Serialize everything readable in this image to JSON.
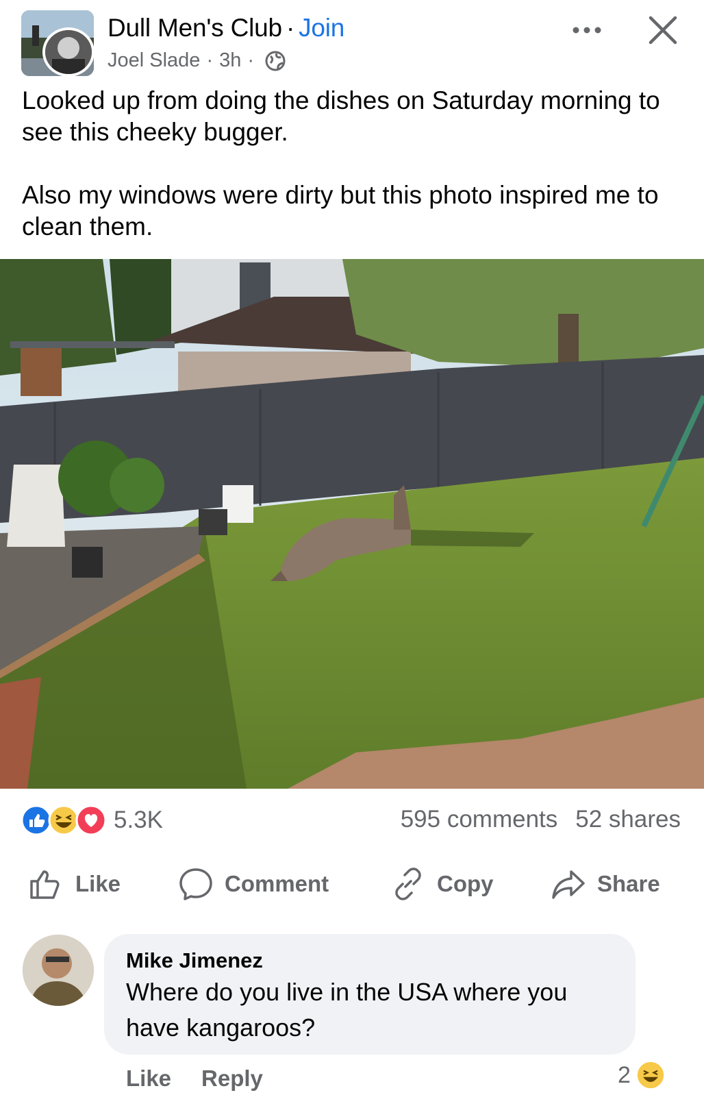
{
  "header": {
    "group_name": "Dull Men's Club",
    "separator": "·",
    "join_label": "Join",
    "author": "Joel Slade",
    "meta_separator": "·",
    "time": "3h",
    "audience_icon": "globe-icon",
    "more_icon": "more-icon",
    "close_icon": "close-icon"
  },
  "post": {
    "paragraph_1": "Looked up from doing the dishes on Saturday morning to see this cheeky bugger.",
    "paragraph_2": "Also my windows were dirty but this photo inspired me to clean them."
  },
  "reactions": {
    "icons": [
      "like-icon",
      "haha-icon",
      "love-icon"
    ],
    "count": "5.3K",
    "comments": "595 comments",
    "shares": "52 shares"
  },
  "actions": {
    "like": "Like",
    "comment": "Comment",
    "copy": "Copy",
    "share": "Share"
  },
  "comment": {
    "author": "Mike Jimenez",
    "text": "Where do you live in the USA where you have kangaroos?",
    "like": "Like",
    "reply": "Reply",
    "reaction_count": "2",
    "reaction_icon": "haha-icon"
  },
  "colors": {
    "accent": "#1b74e4",
    "secondary_text": "#65676b",
    "bubble": "#f0f2f5"
  }
}
